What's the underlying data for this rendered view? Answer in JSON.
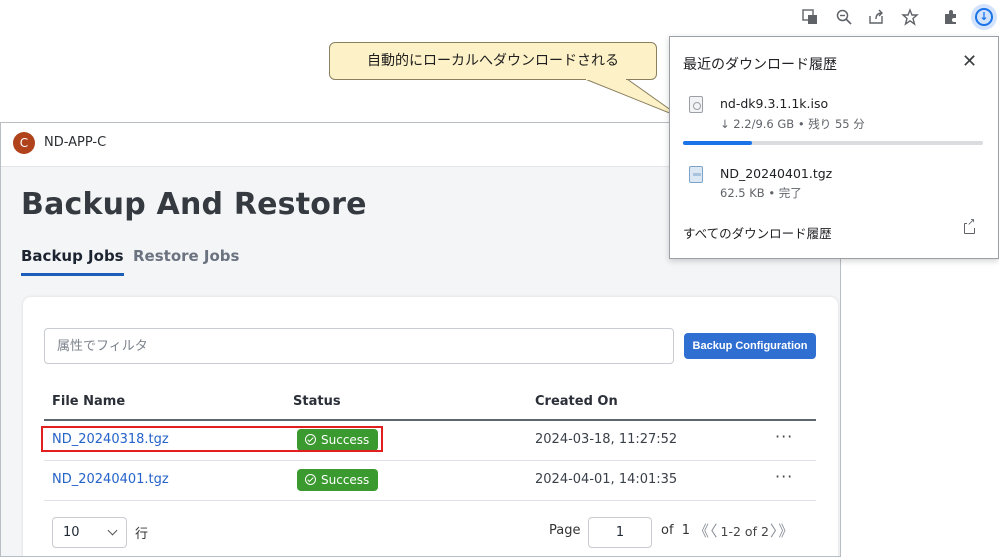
{
  "app": {
    "avatar_letter": "C",
    "name": "ND-APP-C",
    "title": "Backup And Restore",
    "tabs": [
      {
        "label": "Backup Jobs",
        "active": true
      },
      {
        "label": "Restore Jobs",
        "active": false
      }
    ],
    "filter_placeholder": "属性でフィルタ",
    "backup_button": "Backup Configuration",
    "columns": [
      "File Name",
      "Status",
      "Created On"
    ],
    "rows": [
      {
        "file": "ND_20240318.tgz",
        "status": "Success",
        "created": "2024-03-18, 11:27:52",
        "menu": "···"
      },
      {
        "file": "ND_20240401.tgz",
        "status": "Success",
        "created": "2024-04-01, 14:01:35",
        "menu": "···"
      }
    ],
    "pagination": {
      "per_page": "10",
      "rows_label": "行",
      "page_label": "Page",
      "page_value": "1",
      "of_label": "of",
      "total_pages": "1",
      "range": "1-2 of 2"
    },
    "colors": {
      "accent": "#2f6fd1",
      "success": "#3a9a2f",
      "link": "#2563c9",
      "highlight": "#e21f1f"
    }
  },
  "callout": {
    "text": "自動的にローカルへダウンロードされる"
  },
  "browser": {
    "toolbar_icons": [
      "translate-icon",
      "zoom-icon",
      "share-icon",
      "star-icon",
      "extensions-icon",
      "download-icon"
    ],
    "downloads": {
      "title": "最近のダウンロード履歴",
      "close": "✕",
      "items": [
        {
          "name": "nd-dk9.3.1.1k.iso",
          "sub": "↓ 2.2/9.6 GB • 残り 55 分",
          "progress": 0.229
        },
        {
          "name": "ND_20240401.tgz",
          "sub": "62.5 KB • 完了"
        }
      ],
      "footer": "すべてのダウンロード履歴"
    }
  }
}
